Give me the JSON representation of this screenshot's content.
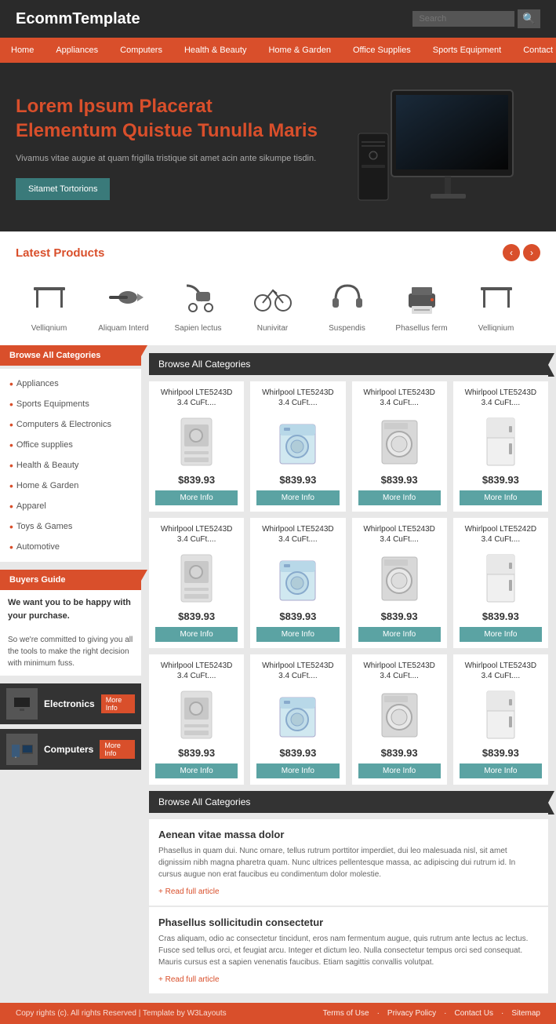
{
  "header": {
    "logo": "EcommTemplate",
    "search_placeholder": "Search",
    "search_icon": "🔍"
  },
  "nav": {
    "items": [
      "Home",
      "Appliances",
      "Computers",
      "Health & Beauty",
      "Home & Garden",
      "Office Supplies",
      "Sports Equipment",
      "Contact Us"
    ]
  },
  "hero": {
    "title_line1": "Lorem Ipsum Placerat",
    "title_line2": "Elementum Quistue Tunulla Maris",
    "description": "Vivamus vitae augue at quam frigilla tristique sit amet acin ante sikumpe tisdin.",
    "button_label": "Sitamet Tortorions"
  },
  "latest": {
    "title": "Latest Products",
    "items": [
      {
        "label": "Velliqnium",
        "icon": "table"
      },
      {
        "label": "Aliquam Interd",
        "icon": "drill"
      },
      {
        "label": "Sapien lectus",
        "icon": "stroller"
      },
      {
        "label": "Nunivitar",
        "icon": "bicycle"
      },
      {
        "label": "Suspendis",
        "icon": "headphones"
      },
      {
        "label": "Phasellus ferm",
        "icon": "printer"
      },
      {
        "label": "Velliqnium",
        "icon": "table"
      }
    ]
  },
  "sidebar": {
    "browse_label": "Browse All Categories",
    "categories": [
      "Appliances",
      "Sports Equipments",
      "Computers & Electronics",
      "Office supplies",
      "Health & Beauty",
      "Home & Garden",
      "Apparel",
      "Toys & Games",
      "Automotive"
    ],
    "buyers_guide_label": "Buyers Guide",
    "buyers_text_title": "We want you to be happy with your purchase.",
    "buyers_text_body": "So we're committed to giving you all the tools to make the right decision with minimum fuss.",
    "promos": [
      {
        "label": "Electronics",
        "more": "More Info"
      },
      {
        "label": "Computers",
        "more": "More Info"
      }
    ]
  },
  "product_grid": {
    "header": "Browse All Categories",
    "products": [
      {
        "title": "Whirlpool LTE5243D 3.4 CuFt....",
        "price": "$839.93",
        "btn": "More Info"
      },
      {
        "title": "Whirlpool LTE5243D 3.4 CuFt....",
        "price": "$839.93",
        "btn": "More Info"
      },
      {
        "title": "Whirlpool LTE5243D 3.4 CuFt....",
        "price": "$839.93",
        "btn": "More Info"
      },
      {
        "title": "Whirlpool LTE5243D 3.4 CuFt....",
        "price": "$839.93",
        "btn": "More Info"
      },
      {
        "title": "Whirlpool LTE5243D 3.4 CuFt....",
        "price": "$839.93",
        "btn": "More Info"
      },
      {
        "title": "Whirlpool LTE5243D 3.4 CuFt....",
        "price": "$839.93",
        "btn": "More Info"
      },
      {
        "title": "Whirlpool LTE5243D 3.4 CuFt....",
        "price": "$839.93",
        "btn": "More Info"
      },
      {
        "title": "Whirlpool LTE5242D 3.4 CuFt....",
        "price": "$839.93",
        "btn": "More Info"
      },
      {
        "title": "Whirlpool LTE5243D 3.4 CuFt....",
        "price": "$839.93",
        "btn": "More Info"
      },
      {
        "title": "Whirlpool LTE5243D 3.4 CuFt....",
        "price": "$839.93",
        "btn": "More Info"
      },
      {
        "title": "Whirlpool LTE5243D 3.4 CuFt....",
        "price": "$839.93",
        "btn": "More Info"
      },
      {
        "title": "Whirlpool LTE5243D 3.4 CuFt....",
        "price": "$839.93",
        "btn": "More Info"
      }
    ]
  },
  "articles": {
    "header": "Browse All Categories",
    "items": [
      {
        "title": "Aenean vitae massa dolor",
        "text": "Phasellus in quam dui. Nunc ornare, tellus rutrum porttitor imperdiet, dui leo malesuada nisl, sit amet dignissim nibh magna pharetra quam. Nunc ultrices pellentesque massa, ac adipiscing dui rutrum id. In cursus augue non erat faucibus eu condimentum dolor molestie.",
        "read_more": "+ Read full article"
      },
      {
        "title": "Phasellus sollicitudin consectetur",
        "text": "Cras aliquam, odio ac consectetur tincidunt, eros nam fermentum augue, quis rutrum ante lectus ac lectus. Fusce sed tellus orci, et feugiat arcu. Integer et dictum leo. Nulla consectetur tempus orci sed consequat. Mauris cursus est a sapien venenatis faucibus. Etiam sagittis convallis volutpat.",
        "read_more": "+ Read full article"
      }
    ]
  },
  "footer": {
    "copy": "Copy rights (c). All rights Reserved | Template by W3Layouts",
    "links": [
      "Terms of Use",
      "Privacy Policy",
      "Contact Us",
      "Sitemap"
    ]
  }
}
